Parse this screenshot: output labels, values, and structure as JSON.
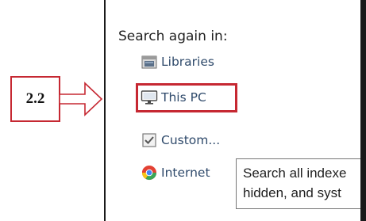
{
  "search_panel": {
    "heading": "Search again in:",
    "options": [
      {
        "label": "Libraries",
        "icon": "libraries-folder-icon"
      },
      {
        "label": "This PC",
        "icon": "computer-monitor-icon"
      },
      {
        "label": "Custom...",
        "icon": "checkbox-checked-icon"
      },
      {
        "label": "Internet",
        "icon": "chrome-icon"
      }
    ]
  },
  "tooltip": {
    "line1": "Search all indexe",
    "line2": "hidden, and syst"
  },
  "callout": {
    "step": "2.2"
  },
  "colors": {
    "highlight": "#c62832",
    "option_text": "#2f4a6b"
  }
}
